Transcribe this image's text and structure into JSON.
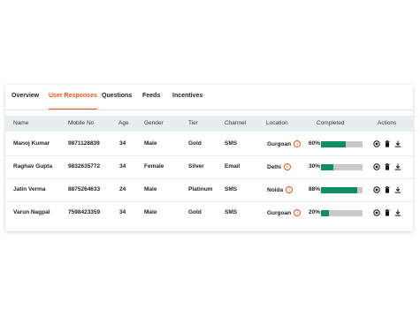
{
  "tabs": [
    {
      "label": "Overview",
      "active": false
    },
    {
      "label": "User Responses",
      "active": true
    },
    {
      "label": "Questions",
      "active": false
    },
    {
      "label": "Feeds",
      "active": false
    },
    {
      "label": "Incentives",
      "active": false
    }
  ],
  "table": {
    "headers": [
      "Name",
      "Mobile No",
      "Age",
      "Gender",
      "Tier",
      "Channel",
      "Location",
      "Completed",
      "Actions"
    ],
    "rows": [
      {
        "name": "Manoj Kumar",
        "mobile": "9871128839",
        "age": "34",
        "gender": "Male",
        "tier": "Gold",
        "channel": "SMS",
        "location": "Gurgoan",
        "completed_label": "60%",
        "completed": 60
      },
      {
        "name": "Raghav Gupta",
        "mobile": "9832635772",
        "age": "34",
        "gender": "Female",
        "tier": "Silver",
        "channel": "Email",
        "location": "Delhi",
        "completed_label": "30%",
        "completed": 30
      },
      {
        "name": "Jatin Verma",
        "mobile": "8875264633",
        "age": "24",
        "gender": "Male",
        "tier": "Platinum",
        "channel": "SMS",
        "location": "Noida",
        "completed_label": "88%",
        "completed": 88
      },
      {
        "name": "Varun Nagpal",
        "mobile": "7598423359",
        "age": "34",
        "gender": "Male",
        "tier": "Gold",
        "channel": "SMS",
        "location": "Gurgoan",
        "completed_label": "20%",
        "completed": 20
      }
    ]
  },
  "icons": {
    "info": "info-icon",
    "view": "view-icon",
    "delete": "trash-icon",
    "download": "download-icon"
  },
  "colors": {
    "accent": "#e8551e",
    "progress_fill": "#0b8f63",
    "progress_track": "#c9c9c9",
    "header_bg": "#e6eef0"
  }
}
